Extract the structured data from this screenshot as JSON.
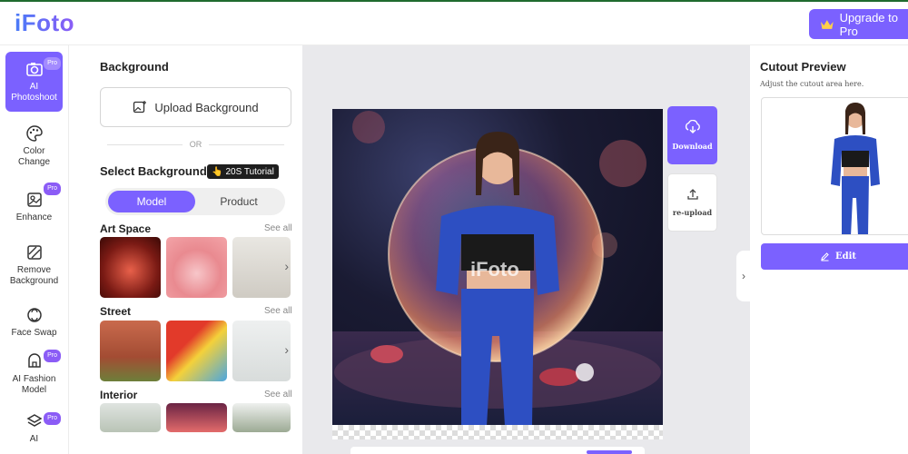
{
  "header": {
    "logo_text": "iFoto",
    "upgrade_label": "Upgrade to Pro",
    "upgrade_icon": "crown-icon"
  },
  "sidebar": {
    "items": [
      {
        "label_line1": "AI",
        "label_line2": "Photoshoot",
        "icon": "camera-icon",
        "pro": "Pro",
        "active": true
      },
      {
        "label_line1": "Color",
        "label_line2": "Change",
        "icon": "palette-icon",
        "pro": "",
        "active": false
      },
      {
        "label_line1": "Enhance",
        "label_line2": "",
        "icon": "enhance-icon",
        "pro": "Pro",
        "active": false
      },
      {
        "label_line1": "Remove",
        "label_line2": "Background",
        "icon": "remove-bg-icon",
        "pro": "",
        "active": false
      },
      {
        "label_line1": "Face Swap",
        "label_line2": "",
        "icon": "face-swap-icon",
        "pro": "",
        "active": false
      },
      {
        "label_line1": "AI Fashion",
        "label_line2": "Model",
        "icon": "hanger-icon",
        "pro": "Pro",
        "active": false
      },
      {
        "label_line1": "AI",
        "label_line2": "",
        "icon": "layers-icon",
        "pro": "Pro",
        "active": false
      }
    ]
  },
  "panel": {
    "title": "Background",
    "upload_label": "Upload Background",
    "or_text": "OR",
    "select_title": "Select Background",
    "tutorial_label": "20S Tutorial",
    "tabs": [
      "Model",
      "Product"
    ],
    "active_tab": "Model",
    "categories": [
      {
        "title": "Art Space",
        "see_all": "See all"
      },
      {
        "title": "Street",
        "see_all": "See all"
      },
      {
        "title": "Interior",
        "see_all": "See all"
      }
    ]
  },
  "canvas": {
    "watermark": "iFoto",
    "download_label": "Download",
    "reupload_label": "re-upload"
  },
  "right_panel": {
    "title": "Cutout Preview",
    "subtitle": "Adjust the cutout area here.",
    "edit_label": "Edit"
  },
  "colors": {
    "accent": "#7b61ff",
    "pro_badge": "#8b5cf6"
  }
}
